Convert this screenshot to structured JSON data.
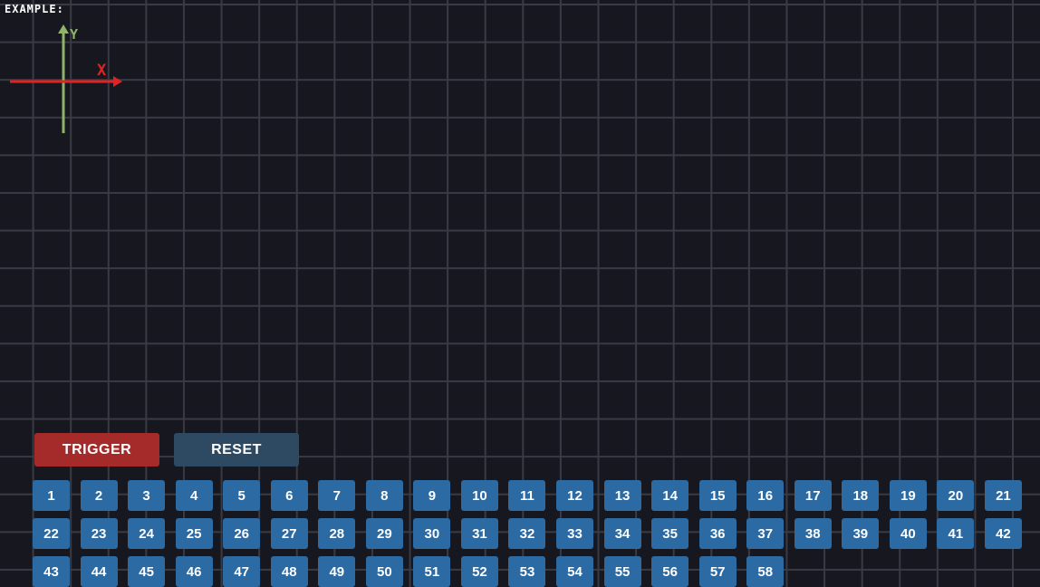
{
  "example_label": "EXAMPLE:",
  "axes": {
    "x_letter": "X",
    "y_letter": "Y"
  },
  "controls": {
    "trigger_label": "TRIGGER",
    "reset_label": "RESET"
  },
  "colors": {
    "background": "#171720",
    "grid_line": "#3a3a44",
    "x_axis": "#e02424",
    "y_axis": "#8fb36a",
    "trigger": "#a52a2a",
    "reset": "#2e4a63",
    "number_button": "#2b6aa3"
  },
  "number_buttons": [
    "1",
    "2",
    "3",
    "4",
    "5",
    "6",
    "7",
    "8",
    "9",
    "10",
    "11",
    "12",
    "13",
    "14",
    "15",
    "16",
    "17",
    "18",
    "19",
    "20",
    "21",
    "22",
    "23",
    "24",
    "25",
    "26",
    "27",
    "28",
    "29",
    "30",
    "31",
    "32",
    "33",
    "34",
    "35",
    "36",
    "37",
    "38",
    "39",
    "40",
    "41",
    "42",
    "43",
    "44",
    "45",
    "46",
    "47",
    "48",
    "49",
    "50",
    "51",
    "52",
    "53",
    "54",
    "55",
    "56",
    "57",
    "58"
  ]
}
